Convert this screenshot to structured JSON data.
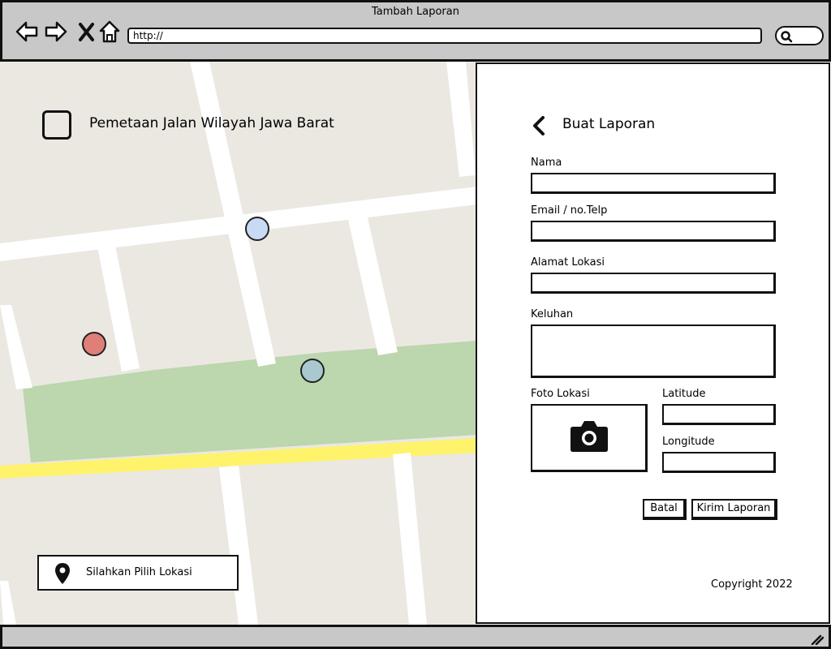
{
  "window": {
    "title": "Tambah Laporan",
    "url": "http://"
  },
  "map": {
    "title": "Pemetaan Jalan Wilayah Jawa Barat",
    "pick_location_label": "Silahkan Pilih Lokasi",
    "marker_colors": [
      "#c9daf5",
      "#e07f78",
      "#a9c8cf"
    ],
    "road_color": "#ffffff",
    "park_color": "#bcd6ad",
    "highway_color": "#fff36b",
    "land_color": "#ebe8e2"
  },
  "form": {
    "title": "Buat Laporan",
    "fields": {
      "nama": {
        "label": "Nama",
        "value": ""
      },
      "email": {
        "label": "Email / no.Telp",
        "value": ""
      },
      "alamat": {
        "label": "Alamat Lokasi",
        "value": ""
      },
      "keluhan": {
        "label": "Keluhan",
        "value": ""
      },
      "foto": {
        "label": "Foto Lokasi"
      },
      "latitude": {
        "label": "Latitude",
        "value": ""
      },
      "longitude": {
        "label": "Longitude",
        "value": ""
      }
    },
    "cancel_label": "Batal",
    "submit_label": "Kirim Laporan",
    "copyright": "Copyright 2022"
  },
  "icons": {
    "back": "arrow-left-icon",
    "forward": "arrow-right-icon",
    "close": "close-icon",
    "home": "home-icon",
    "search": "search-icon",
    "chevron_back": "chevron-left-icon",
    "camera": "camera-icon",
    "map_pin": "map-pin-icon",
    "resize": "resize-grip-icon"
  }
}
